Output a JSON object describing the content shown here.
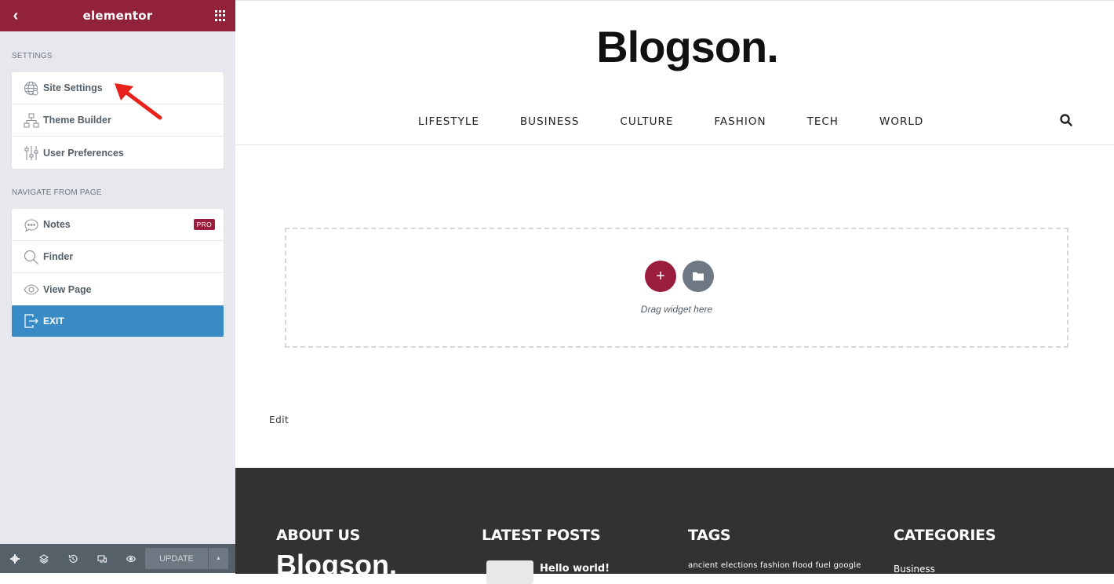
{
  "panel": {
    "logo": "elementor",
    "settings_title": "SETTINGS",
    "settings_items": [
      {
        "label": "Site Settings",
        "icon": "globe-icon"
      },
      {
        "label": "Theme Builder",
        "icon": "sitemap-icon"
      },
      {
        "label": "User Preferences",
        "icon": "sliders-icon"
      }
    ],
    "navigate_title": "NAVIGATE FROM PAGE",
    "navigate_items": [
      {
        "label": "Notes",
        "icon": "comment-icon",
        "badge": "PRO"
      },
      {
        "label": "Finder",
        "icon": "search-icon"
      },
      {
        "label": "View Page",
        "icon": "eye-icon"
      }
    ],
    "exit_label": "EXIT",
    "footer": {
      "icons": [
        "settings-icon",
        "layers-icon",
        "history-icon",
        "responsive-icon",
        "preview-icon"
      ],
      "update_label": "UPDATE"
    }
  },
  "site": {
    "title": "Blogson.",
    "nav": [
      "LIFESTYLE",
      "BUSINESS",
      "CULTURE",
      "FASHION",
      "TECH",
      "WORLD"
    ],
    "drop_zone_text": "Drag widget here",
    "edit_link": "Edit",
    "footer": {
      "about_heading": "ABOUT US",
      "latest_heading": "LATEST POSTS",
      "tags_heading": "TAGS",
      "categories_heading": "CATEGORIES",
      "logo": "Blogson.",
      "latest_post_title": "Hello world!",
      "tags": "ancient elections fashion flood fuel google",
      "category": "Business"
    }
  },
  "colors": {
    "brand": "#9b1d3e",
    "exit": "#398bc5",
    "panel_bg": "#e6e8ed",
    "footer_bg": "#323232"
  }
}
